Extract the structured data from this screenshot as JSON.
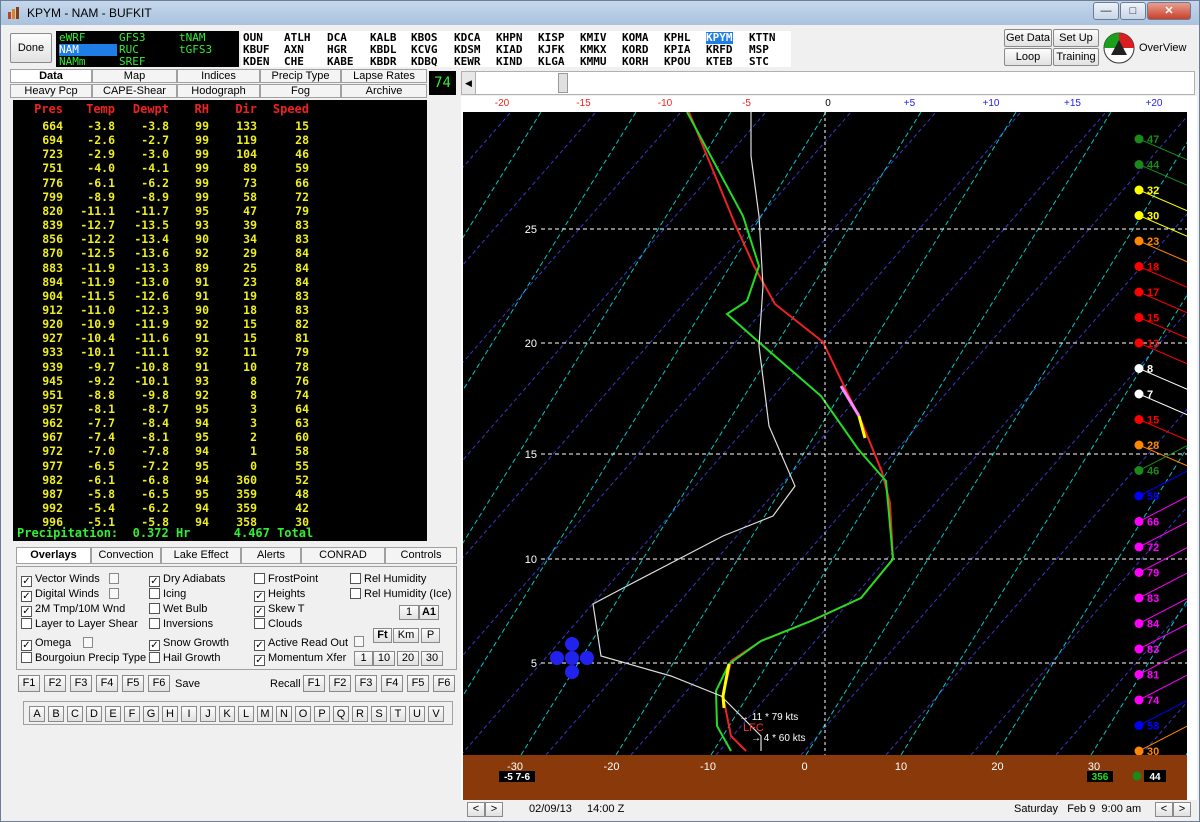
{
  "window": {
    "title": "KPYM - NAM - BUFKIT"
  },
  "topbar": {
    "done_label": "Done",
    "models": [
      "eWRF",
      "GFS3",
      "tNAM",
      "NAM",
      "RUC",
      "tGFS3",
      "NAMm",
      "SREF"
    ],
    "selected_model": "NAM",
    "stations": [
      [
        "OUN",
        "ATLH",
        "DCA",
        "KALB",
        "KBOS",
        "KDCA",
        "KHPN",
        "KISP",
        "KMIV",
        "KOMA",
        "KPHL",
        "KPYM",
        "KTTN"
      ],
      [
        "KBUF",
        "AXN",
        "HGR",
        "KBDL",
        "KCVG",
        "KDSM",
        "KIAD",
        "KJFK",
        "KMKX",
        "KORD",
        "KPIA",
        "KRFD",
        "MSP"
      ],
      [
        "KDEN",
        "CHE",
        "KABE",
        "KBDR",
        "KDBQ",
        "KEWR",
        "KIND",
        "KLGA",
        "KMMU",
        "KORH",
        "KPOU",
        "KTEB",
        "STC"
      ]
    ],
    "selected_station": "KPYM",
    "right_buttons": [
      "Get Data",
      "Set Up",
      "Loop",
      "Training"
    ],
    "overview_label": "OverView"
  },
  "tabs_row1": [
    "Data",
    "Map",
    "Indices",
    "Precip Type",
    "Lapse Rates"
  ],
  "tabs_row2": [
    "Heavy Pcp",
    "CAPE-Shear",
    "Hodograph",
    "Fog",
    "Archive"
  ],
  "hour_value": "74",
  "table": {
    "headers": [
      "Pres",
      "Temp",
      "Dewpt",
      "RH",
      "Dir",
      "Speed"
    ],
    "rows": [
      [
        "664",
        "-3.8",
        "-3.8",
        "99",
        "133",
        "15"
      ],
      [
        "694",
        "-2.6",
        "-2.7",
        "99",
        "119",
        "28"
      ],
      [
        "723",
        "-2.9",
        "-3.0",
        "99",
        "104",
        "46"
      ],
      [
        "751",
        "-4.0",
        "-4.1",
        "99",
        "89",
        "59"
      ],
      [
        "776",
        "-6.1",
        "-6.2",
        "99",
        "73",
        "66"
      ],
      [
        "799",
        "-8.9",
        "-8.9",
        "99",
        "58",
        "72"
      ],
      [
        "820",
        "-11.1",
        "-11.7",
        "95",
        "47",
        "79"
      ],
      [
        "839",
        "-12.7",
        "-13.5",
        "93",
        "39",
        "83"
      ],
      [
        "856",
        "-12.2",
        "-13.4",
        "90",
        "34",
        "83"
      ],
      [
        "870",
        "-12.5",
        "-13.6",
        "92",
        "29",
        "84"
      ],
      [
        "883",
        "-11.9",
        "-13.3",
        "89",
        "25",
        "84"
      ],
      [
        "894",
        "-11.9",
        "-13.0",
        "91",
        "23",
        "84"
      ],
      [
        "904",
        "-11.5",
        "-12.6",
        "91",
        "19",
        "83"
      ],
      [
        "912",
        "-11.0",
        "-12.3",
        "90",
        "18",
        "83"
      ],
      [
        "920",
        "-10.9",
        "-11.9",
        "92",
        "15",
        "82"
      ],
      [
        "927",
        "-10.4",
        "-11.6",
        "91",
        "15",
        "81"
      ],
      [
        "933",
        "-10.1",
        "-11.1",
        "92",
        "11",
        "79"
      ],
      [
        "939",
        "-9.7",
        "-10.8",
        "91",
        "10",
        "78"
      ],
      [
        "945",
        "-9.2",
        "-10.1",
        "93",
        "8",
        "76"
      ],
      [
        "951",
        "-8.8",
        "-9.8",
        "92",
        "8",
        "74"
      ],
      [
        "957",
        "-8.1",
        "-8.7",
        "95",
        "3",
        "64"
      ],
      [
        "962",
        "-7.7",
        "-8.4",
        "94",
        "3",
        "63"
      ],
      [
        "967",
        "-7.4",
        "-8.1",
        "95",
        "2",
        "60"
      ],
      [
        "972",
        "-7.0",
        "-7.8",
        "94",
        "1",
        "58"
      ],
      [
        "977",
        "-6.5",
        "-7.2",
        "95",
        "0",
        "55"
      ],
      [
        "982",
        "-6.1",
        "-6.8",
        "94",
        "360",
        "52"
      ],
      [
        "987",
        "-5.8",
        "-6.5",
        "95",
        "359",
        "48"
      ],
      [
        "992",
        "-5.4",
        "-6.2",
        "94",
        "359",
        "42"
      ],
      [
        "996",
        "-5.1",
        "-5.8",
        "94",
        "358",
        "30"
      ]
    ],
    "precip_text": "Precipitation:  0.372 Hr      4.467 Total"
  },
  "tabs_row3": [
    "Overlays",
    "Convection",
    "Lake Effect",
    "Alerts",
    "CONRAD",
    "Controls"
  ],
  "overlays": [
    {
      "label": "Vector Winds",
      "checked": true
    },
    {
      "label": "Digital Winds",
      "checked": true
    },
    {
      "label": "2M Tmp/10M Wnd",
      "checked": true
    },
    {
      "label": "Layer to Layer Shear",
      "checked": false
    },
    {
      "label": "Omega",
      "checked": true
    },
    {
      "label": "Bourgoiun Precip Type",
      "checked": false
    },
    {
      "label": "Dry Adiabats",
      "checked": true
    },
    {
      "label": "Icing",
      "checked": false
    },
    {
      "label": "Wet Bulb",
      "checked": false
    },
    {
      "label": "Inversions",
      "checked": false
    },
    {
      "label": "Snow Growth",
      "checked": true
    },
    {
      "label": "Hail Growth",
      "checked": false
    },
    {
      "label": "FrostPoint",
      "checked": false
    },
    {
      "label": "Heights",
      "checked": true
    },
    {
      "label": "Skew T",
      "checked": true
    },
    {
      "label": "Clouds",
      "checked": false
    },
    {
      "label": "Active Read Out",
      "checked": true
    },
    {
      "label": "Momentum Xfer",
      "checked": true
    },
    {
      "label": "Rel Humidity",
      "checked": false
    },
    {
      "label": "Rel Humidity (Ice)",
      "checked": false
    }
  ],
  "small_buttons": [
    "1",
    "A1",
    "Ft",
    "Km",
    "P",
    "1",
    "10",
    "20",
    "30"
  ],
  "fkeys_left": [
    "F1",
    "F2",
    "F3",
    "F4",
    "F5",
    "F6"
  ],
  "save_label": "Save",
  "recall_label": "Recall",
  "fkeys_right": [
    "F1",
    "F2",
    "F3",
    "F4",
    "F5",
    "F6"
  ],
  "letters": [
    "A",
    "B",
    "C",
    "D",
    "E",
    "F",
    "G",
    "H",
    "I",
    "J",
    "K",
    "L",
    "M",
    "N",
    "O",
    "P",
    "Q",
    "R",
    "S",
    "T",
    "U",
    "V"
  ],
  "plot": {
    "top_scale": [
      "-20",
      "-15",
      "-10",
      "-5",
      "0",
      "+5",
      "+10",
      "+15",
      "+20"
    ],
    "top_scale_colors": [
      "#ee2222",
      "#ee2222",
      "#ee2222",
      "#ee2222",
      "#000000",
      "#2222ee",
      "#2222ee",
      "#2222ee",
      "#2222ee"
    ],
    "height_labels": [
      "25",
      "20",
      "15",
      "10",
      "5"
    ],
    "bottom_scale": [
      "-30",
      "-20",
      "-10",
      "0",
      "10",
      "20",
      "30"
    ],
    "bottom_left_readout": "-5 7-6",
    "bottom_right_readout": "356",
    "bottom_right_speed": "44",
    "annotation_1": "11 * 79 kts",
    "annotation_lfc": "LFC",
    "annotation_2": "4 * 60 kts",
    "wind_speeds": [
      "47",
      "44",
      "32",
      "30",
      "23",
      "18",
      "17",
      "15",
      "13",
      "8",
      "7",
      "15",
      "28",
      "46",
      "59",
      "66",
      "72",
      "79",
      "83",
      "84",
      "83",
      "81",
      "74",
      "58",
      "30"
    ],
    "wind_colors": [
      "#1a8a1a",
      "#1a8a1a",
      "#ffff00",
      "#ffff00",
      "#ff8800",
      "#ff0000",
      "#ff0000",
      "#ff0000",
      "#ff0000",
      "#ffffff",
      "#ffffff",
      "#ff0000",
      "#ff8800",
      "#1a8a1a",
      "#0000ff",
      "#ff00ff",
      "#ff00ff",
      "#ff00ff",
      "#ff00ff",
      "#ff00ff",
      "#ff00ff",
      "#ff00ff",
      "#ff00ff",
      "#0000ff",
      "#ff8800"
    ]
  },
  "status": {
    "date": "02/09/13",
    "time": "14:00 Z",
    "valid": "Saturday   Feb 9  9:00 am"
  }
}
